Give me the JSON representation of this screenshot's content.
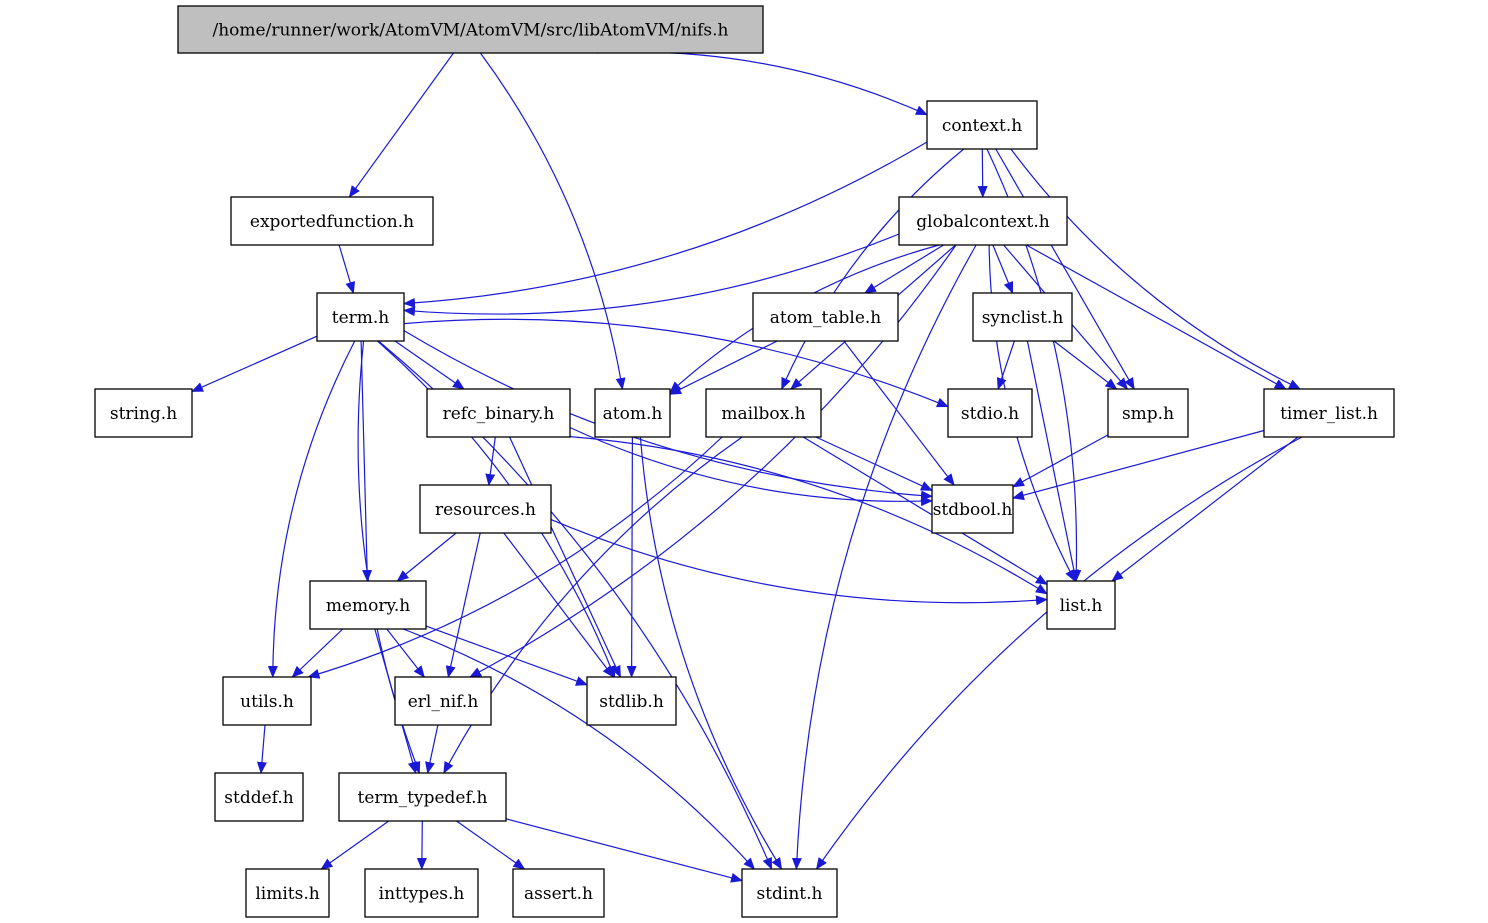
{
  "diagram": {
    "title": "/home/runner/work/AtomVM/AtomVM/src/libAtomVM/nifs.h",
    "edge_color": "#1a1ad6",
    "root_fill": "#bfbfbf",
    "nodes": [
      {
        "id": "nifs",
        "label": "/home/runner/work/AtomVM/AtomVM/src/libAtomVM/nifs.h",
        "root": true
      },
      {
        "id": "context",
        "label": "context.h"
      },
      {
        "id": "exportedfunction",
        "label": "exportedfunction.h"
      },
      {
        "id": "globalcontext",
        "label": "globalcontext.h"
      },
      {
        "id": "term",
        "label": "term.h"
      },
      {
        "id": "atom_table",
        "label": "atom_table.h"
      },
      {
        "id": "synclist",
        "label": "synclist.h"
      },
      {
        "id": "string",
        "label": "string.h"
      },
      {
        "id": "refc_binary",
        "label": "refc_binary.h"
      },
      {
        "id": "atom",
        "label": "atom.h"
      },
      {
        "id": "mailbox",
        "label": "mailbox.h"
      },
      {
        "id": "stdio",
        "label": "stdio.h"
      },
      {
        "id": "smp",
        "label": "smp.h"
      },
      {
        "id": "timer_list",
        "label": "timer_list.h"
      },
      {
        "id": "resources",
        "label": "resources.h"
      },
      {
        "id": "stdbool",
        "label": "stdbool.h"
      },
      {
        "id": "memory",
        "label": "memory.h"
      },
      {
        "id": "list",
        "label": "list.h"
      },
      {
        "id": "utils",
        "label": "utils.h"
      },
      {
        "id": "erl_nif",
        "label": "erl_nif.h"
      },
      {
        "id": "stdlib",
        "label": "stdlib.h"
      },
      {
        "id": "stddef",
        "label": "stddef.h"
      },
      {
        "id": "term_typedef",
        "label": "term_typedef.h"
      },
      {
        "id": "limits",
        "label": "limits.h"
      },
      {
        "id": "inttypes",
        "label": "inttypes.h"
      },
      {
        "id": "assert",
        "label": "assert.h"
      },
      {
        "id": "stdint",
        "label": "stdint.h"
      }
    ],
    "edges": [
      [
        "nifs",
        "context"
      ],
      [
        "nifs",
        "exportedfunction"
      ],
      [
        "nifs",
        "atom"
      ],
      [
        "context",
        "globalcontext"
      ],
      [
        "context",
        "term"
      ],
      [
        "context",
        "mailbox"
      ],
      [
        "context",
        "smp"
      ],
      [
        "context",
        "timer_list"
      ],
      [
        "context",
        "list"
      ],
      [
        "exportedfunction",
        "term"
      ],
      [
        "globalcontext",
        "term"
      ],
      [
        "globalcontext",
        "atom_table"
      ],
      [
        "globalcontext",
        "synclist"
      ],
      [
        "globalcontext",
        "atom"
      ],
      [
        "globalcontext",
        "mailbox"
      ],
      [
        "globalcontext",
        "smp"
      ],
      [
        "globalcontext",
        "timer_list"
      ],
      [
        "globalcontext",
        "list"
      ],
      [
        "globalcontext",
        "erl_nif"
      ],
      [
        "globalcontext",
        "stdint"
      ],
      [
        "term",
        "string"
      ],
      [
        "term",
        "refc_binary"
      ],
      [
        "term",
        "stdio"
      ],
      [
        "term",
        "stdbool"
      ],
      [
        "term",
        "memory"
      ],
      [
        "term",
        "utils"
      ],
      [
        "term",
        "stdlib"
      ],
      [
        "term",
        "term_typedef"
      ],
      [
        "term",
        "stdint"
      ],
      [
        "atom_table",
        "atom"
      ],
      [
        "atom_table",
        "stdbool"
      ],
      [
        "synclist",
        "stdio"
      ],
      [
        "synclist",
        "smp"
      ],
      [
        "synclist",
        "list"
      ],
      [
        "refc_binary",
        "resources"
      ],
      [
        "refc_binary",
        "stdbool"
      ],
      [
        "refc_binary",
        "list"
      ],
      [
        "refc_binary",
        "stdlib"
      ],
      [
        "atom",
        "stdlib"
      ],
      [
        "atom",
        "stdint"
      ],
      [
        "mailbox",
        "stdbool"
      ],
      [
        "mailbox",
        "list"
      ],
      [
        "mailbox",
        "utils"
      ],
      [
        "mailbox",
        "term_typedef"
      ],
      [
        "smp",
        "stdbool"
      ],
      [
        "timer_list",
        "stdbool"
      ],
      [
        "timer_list",
        "list"
      ],
      [
        "timer_list",
        "stdint"
      ],
      [
        "resources",
        "memory"
      ],
      [
        "resources",
        "erl_nif"
      ],
      [
        "resources",
        "stdlib"
      ],
      [
        "resources",
        "list"
      ],
      [
        "memory",
        "utils"
      ],
      [
        "memory",
        "erl_nif"
      ],
      [
        "memory",
        "stdlib"
      ],
      [
        "memory",
        "term_typedef"
      ],
      [
        "memory",
        "stdint"
      ],
      [
        "utils",
        "stddef"
      ],
      [
        "erl_nif",
        "term_typedef"
      ],
      [
        "term_typedef",
        "limits"
      ],
      [
        "term_typedef",
        "inttypes"
      ],
      [
        "term_typedef",
        "assert"
      ],
      [
        "term_typedef",
        "stdint"
      ]
    ]
  }
}
